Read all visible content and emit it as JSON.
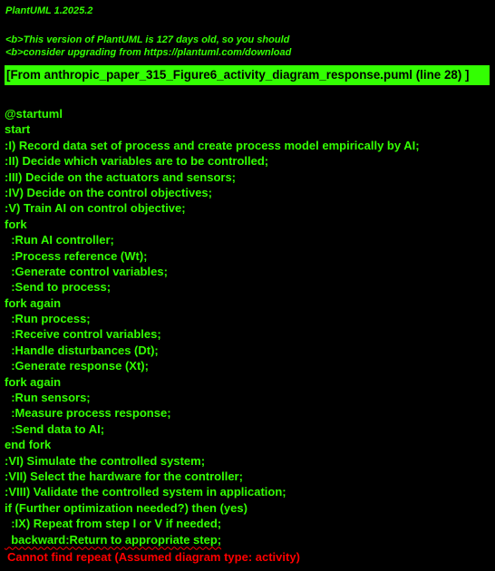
{
  "header": {
    "version": "PlantUML 1.2025.2",
    "notice_line1": "<b>This version of PlantUML is 127 days old, so you should",
    "notice_line2": "<b>consider upgrading from https://plantuml.com/download"
  },
  "banner": "[From anthropic_paper_315_Figure6_activity_diagram_response.puml (line 28) ]",
  "code_lines": [
    "@startuml",
    "start",
    ":I) Record data set of process and create process model empirically by AI;",
    ":II) Decide which variables are to be controlled;",
    ":III) Decide on the actuators and sensors;",
    ":IV) Decide on the control objectives;",
    ":V) Train AI on control objective;",
    "fork",
    "  :Run AI controller;",
    "  :Process reference (Wt);",
    "  :Generate control variables;",
    "  :Send to process;",
    "fork again",
    "  :Run process;",
    "  :Receive control variables;",
    "  :Handle disturbances (Dt);",
    "  :Generate response (Xt);",
    "fork again",
    "  :Run sensors;",
    "  :Measure process response;",
    "  :Send data to AI;",
    "end fork",
    ":VI) Simulate the controlled system;",
    ":VII) Select the hardware for the controller;",
    ":VIII) Validate the controlled system in application;",
    "if (Further optimization needed?) then (yes)",
    "  :IX) Repeat from step I or V if needed;",
    "  backward:Return to appropriate step;"
  ],
  "error_message": "Cannot find repeat (Assumed diagram type: activity)",
  "colors": {
    "text": "#33FF02",
    "banner": "#33FF02",
    "error": "#FF0000",
    "background": "#000000"
  }
}
